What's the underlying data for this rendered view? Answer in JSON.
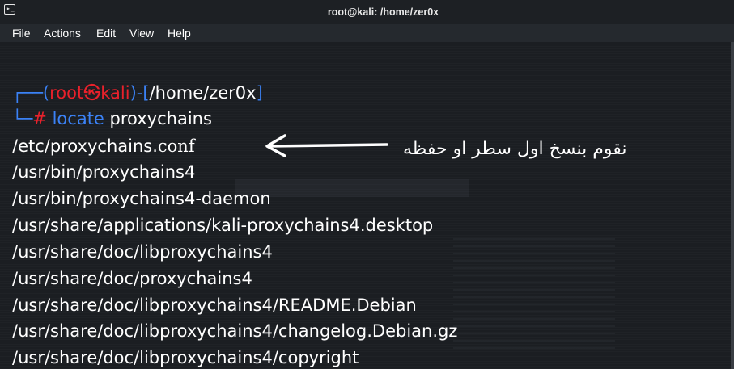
{
  "window": {
    "title": "root@kali: /home/zer0x"
  },
  "menu": [
    "File",
    "Actions",
    "Edit",
    "View",
    "Help"
  ],
  "prompt": {
    "corner_top": "┌──(",
    "user": "root",
    "at_symbol": "㉿",
    "host": "kali",
    "bracket_mid": ")-[",
    "path": "/home/zer0x",
    "bracket_end": "]",
    "corner_bottom": "└─",
    "hash": "#",
    "command": "locate",
    "argument": "proxychains"
  },
  "output": {
    "first_prefix": "/etc/proxychains.",
    "first_suffix": "conf",
    "lines": [
      "/usr/bin/proxychains4",
      "/usr/bin/proxychains4-daemon",
      "/usr/share/applications/kali-proxychains4.desktop",
      "/usr/share/doc/libproxychains4",
      "/usr/share/doc/proxychains4",
      "/usr/share/doc/libproxychains4/README.Debian",
      "/usr/share/doc/libproxychains4/changelog.Debian.gz",
      "/usr/share/doc/libproxychains4/copyright"
    ]
  },
  "annotation": "نقوم بنسخ اول سطر او حفظه",
  "colors": {
    "prompt_blue": "#3b82f6",
    "prompt_red": "#e8212b",
    "text": "#ffffff"
  }
}
